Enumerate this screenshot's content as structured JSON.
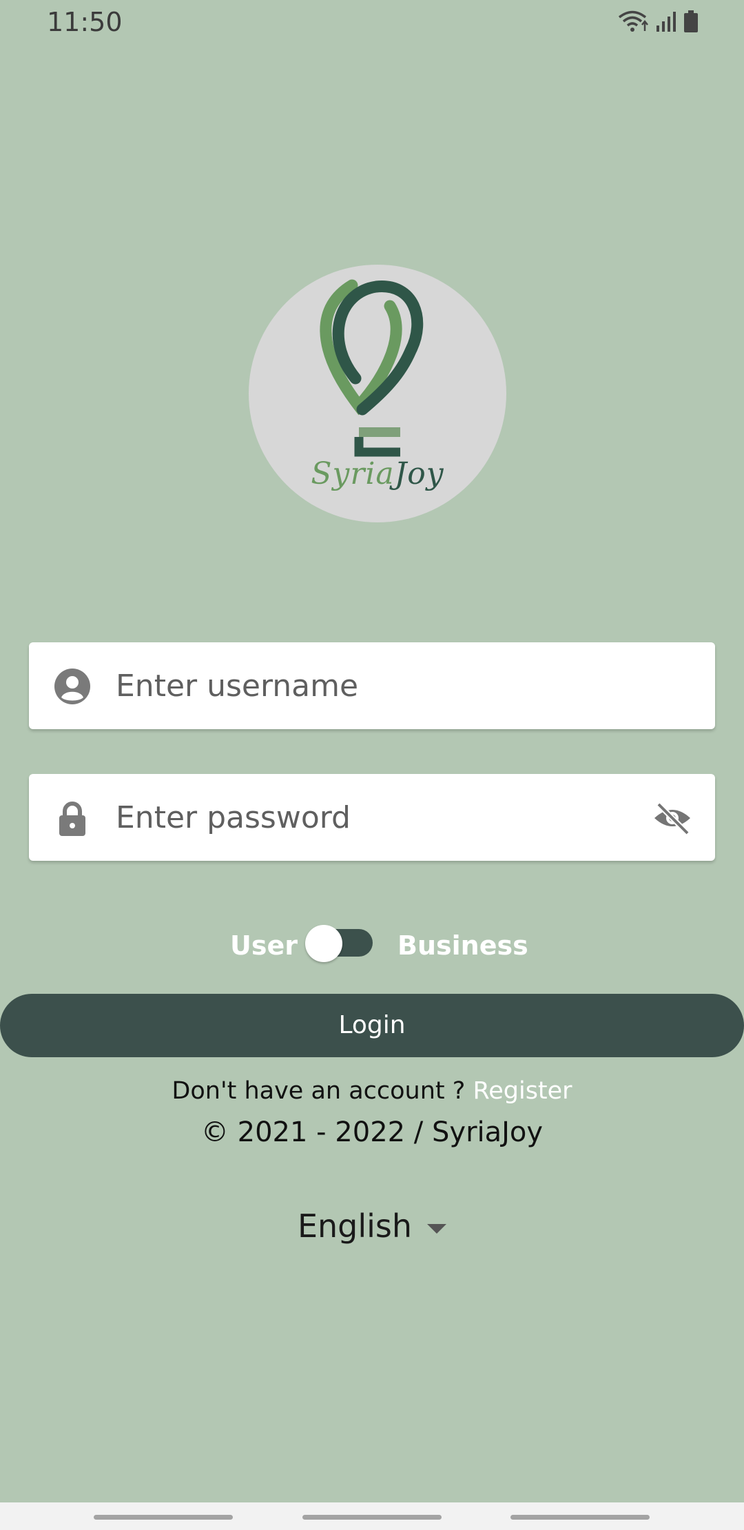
{
  "status_bar": {
    "time": "11:50"
  },
  "logo": {
    "text_part1": "Syria",
    "text_part2": "Joy",
    "colors": {
      "light_green": "#6a9a60",
      "dark_green": "#2f5648"
    }
  },
  "username": {
    "placeholder": "Enter username",
    "icon": "account-circle-icon"
  },
  "password": {
    "placeholder": "Enter password",
    "icon": "lock-icon",
    "visibility_icon": "eye-off-icon"
  },
  "account_type": {
    "left_label": "User",
    "right_label": "Business"
  },
  "login_button": {
    "label": "Login"
  },
  "register": {
    "prompt": "Don't have an account ? ",
    "link": "Register"
  },
  "copyright": "© 2021 - 2022 / SyriaJoy",
  "language": {
    "selected": "English"
  },
  "theme": {
    "background": "#b3c7b3",
    "primary": "#3c504c"
  }
}
